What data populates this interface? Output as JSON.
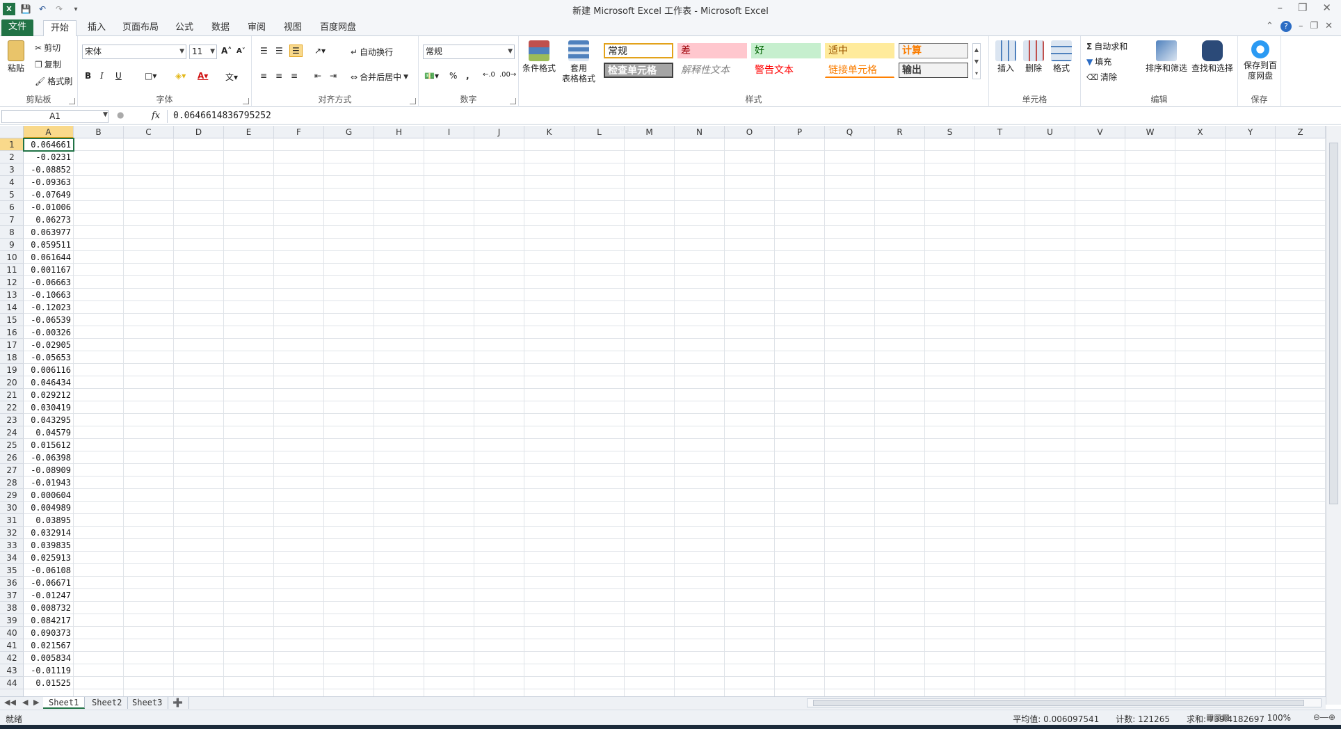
{
  "window": {
    "title": "新建 Microsoft Excel 工作表 - Microsoft Excel",
    "quick_access": [
      "save-icon",
      "undo-icon",
      "redo-icon",
      "customize-icon"
    ]
  },
  "tabs": [
    {
      "label": "文件"
    },
    {
      "label": "开始"
    },
    {
      "label": "插入"
    },
    {
      "label": "页面布局"
    },
    {
      "label": "公式"
    },
    {
      "label": "数据"
    },
    {
      "label": "审阅"
    },
    {
      "label": "视图"
    },
    {
      "label": "百度网盘"
    }
  ],
  "ribbon": {
    "clipboard": {
      "paste": "粘贴",
      "cut": "剪切",
      "copy": "复制",
      "format_painter": "格式刷",
      "label": "剪贴板"
    },
    "font": {
      "name": "宋体",
      "size": "11",
      "bold": "B",
      "italic": "I",
      "underline": "U",
      "label": "字体"
    },
    "alignment": {
      "wrap": "自动换行",
      "merge": "合并后居中",
      "label": "对齐方式"
    },
    "number": {
      "format": "常规",
      "percent": "%",
      "comma": ",",
      "label": "数字"
    },
    "styles": {
      "conditional": "条件格式",
      "table_a": "套用",
      "table_b": "表格格式",
      "cells": [
        {
          "text": "常规",
          "bg": "#ffffff",
          "color": "#000000"
        },
        {
          "text": "差",
          "bg": "#ffc7ce",
          "color": "#9c0006"
        },
        {
          "text": "好",
          "bg": "#c6efce",
          "color": "#006100"
        },
        {
          "text": "适中",
          "bg": "#ffeb9c",
          "color": "#9c5700"
        },
        {
          "text": "计算",
          "bg": "#f2f2f2",
          "color": "#fa7d00"
        },
        {
          "text": "检查单元格",
          "bg": "#a5a5a5",
          "color": "#ffffff"
        },
        {
          "text": "解释性文本",
          "bg": "#ffffff",
          "color": "#7f7f7f"
        },
        {
          "text": "警告文本",
          "bg": "#ffffff",
          "color": "#ff0000"
        },
        {
          "text": "链接单元格",
          "bg": "#ffffff",
          "color": "#fa7d00"
        },
        {
          "text": "输出",
          "bg": "#f2f2f2",
          "color": "#3f3f3f"
        }
      ],
      "label": "样式"
    },
    "cells_group": {
      "insert": "插入",
      "delete": "删除",
      "format": "格式",
      "label": "单元格"
    },
    "editing": {
      "autosum": "自动求和",
      "fill": "填充",
      "clear": "清除",
      "sort": "排序和筛选",
      "find": "查找和选择",
      "label": "编辑"
    },
    "save": {
      "button_a": "保存到百",
      "button_b": "度网盘",
      "label": "保存"
    }
  },
  "formula_bar": {
    "name_box": "A1",
    "fx": "fx",
    "formula": "0.0646614836795252"
  },
  "columns": [
    "A",
    "B",
    "C",
    "D",
    "E",
    "F",
    "G",
    "H",
    "I",
    "J",
    "K",
    "L",
    "M",
    "N",
    "O",
    "P",
    "Q",
    "R",
    "S",
    "T",
    "U",
    "V",
    "W",
    "X",
    "Y",
    "Z"
  ],
  "rows": [
    {
      "n": "1",
      "a": "0.064661"
    },
    {
      "n": "2",
      "a": "-0.0231"
    },
    {
      "n": "3",
      "a": "-0.08852"
    },
    {
      "n": "4",
      "a": "-0.09363"
    },
    {
      "n": "5",
      "a": "-0.07649"
    },
    {
      "n": "6",
      "a": "-0.01006"
    },
    {
      "n": "7",
      "a": "0.06273"
    },
    {
      "n": "8",
      "a": "0.063977"
    },
    {
      "n": "9",
      "a": "0.059511"
    },
    {
      "n": "10",
      "a": "0.061644"
    },
    {
      "n": "11",
      "a": "0.001167"
    },
    {
      "n": "12",
      "a": "-0.06663"
    },
    {
      "n": "13",
      "a": "-0.10663"
    },
    {
      "n": "14",
      "a": "-0.12023"
    },
    {
      "n": "15",
      "a": "-0.06539"
    },
    {
      "n": "16",
      "a": "-0.00326"
    },
    {
      "n": "17",
      "a": "-0.02905"
    },
    {
      "n": "18",
      "a": "-0.05653"
    },
    {
      "n": "19",
      "a": "0.006116"
    },
    {
      "n": "20",
      "a": "0.046434"
    },
    {
      "n": "21",
      "a": "0.029212"
    },
    {
      "n": "22",
      "a": "0.030419"
    },
    {
      "n": "23",
      "a": "0.043295"
    },
    {
      "n": "24",
      "a": "0.04579"
    },
    {
      "n": "25",
      "a": "0.015612"
    },
    {
      "n": "26",
      "a": "-0.06398"
    },
    {
      "n": "27",
      "a": "-0.08909"
    },
    {
      "n": "28",
      "a": "-0.01943"
    },
    {
      "n": "29",
      "a": "0.000604"
    },
    {
      "n": "30",
      "a": "0.004989"
    },
    {
      "n": "31",
      "a": "0.03895"
    },
    {
      "n": "32",
      "a": "0.032914"
    },
    {
      "n": "33",
      "a": "0.039835"
    },
    {
      "n": "34",
      "a": "0.025913"
    },
    {
      "n": "35",
      "a": "-0.06108"
    },
    {
      "n": "36",
      "a": "-0.06671"
    },
    {
      "n": "37",
      "a": "-0.01247"
    },
    {
      "n": "38",
      "a": "0.008732"
    },
    {
      "n": "39",
      "a": "0.084217"
    },
    {
      "n": "40",
      "a": "0.090373"
    },
    {
      "n": "41",
      "a": "0.021567"
    },
    {
      "n": "42",
      "a": "0.005834"
    },
    {
      "n": "43",
      "a": "-0.01119"
    },
    {
      "n": "44",
      "a": "0.01525"
    }
  ],
  "sheets": [
    "Sheet1",
    "Sheet2",
    "Sheet3"
  ],
  "status": {
    "ready": "就绪",
    "average": "平均值: 0.006097541",
    "count": "计数: 121265",
    "sum": "求和: 739.4182697",
    "zoom": "100%"
  },
  "colors": {
    "accent": "#217346",
    "selected_header": "#f9d98b"
  }
}
